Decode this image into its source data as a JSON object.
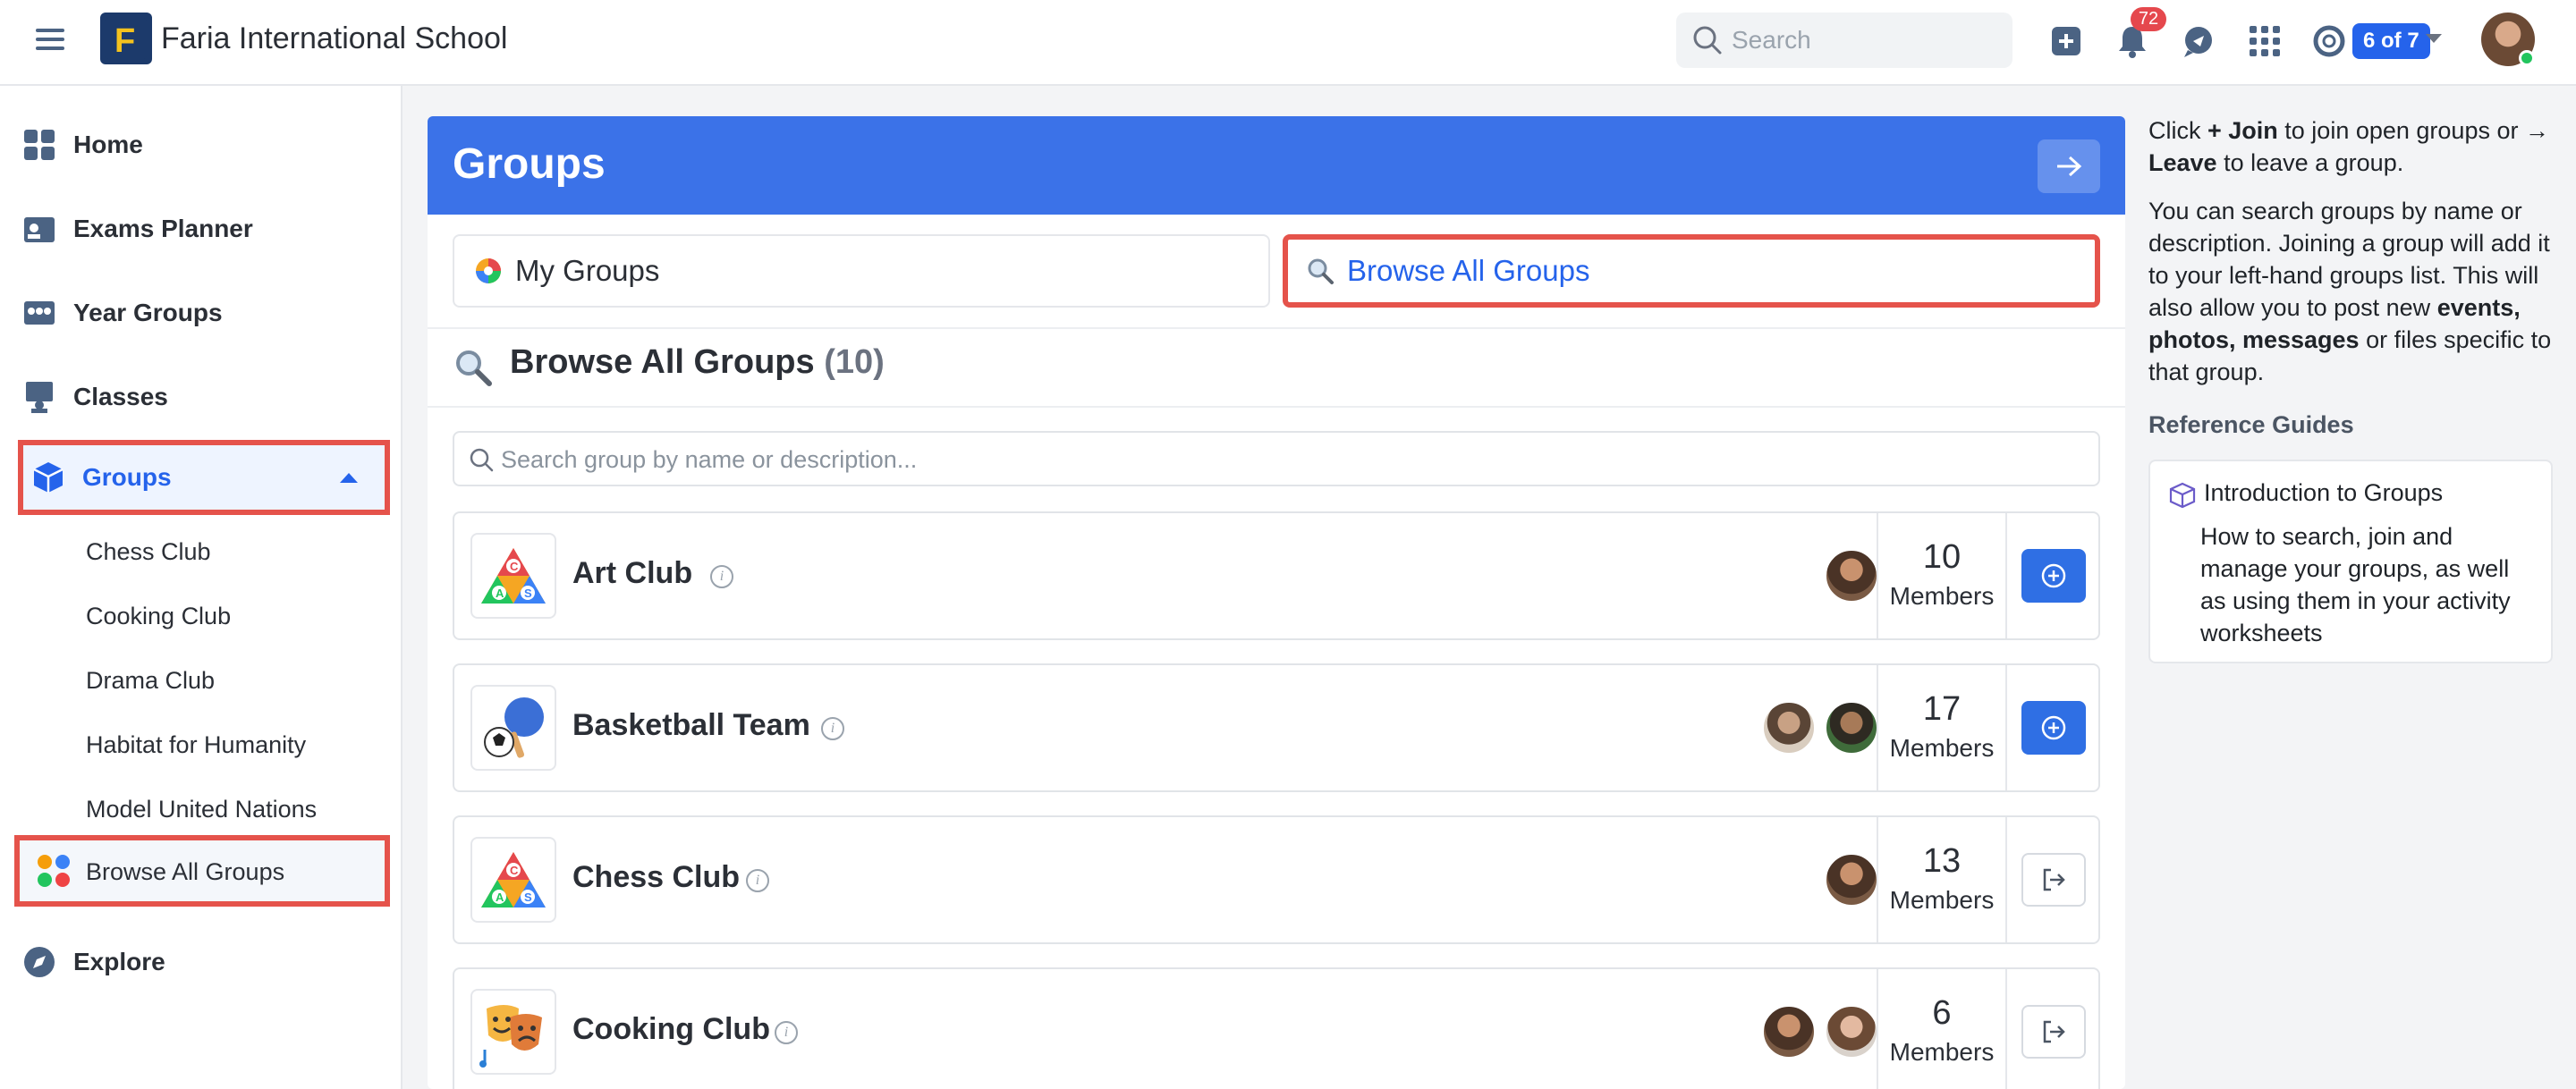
{
  "topbar": {
    "school_name": "Faria International School",
    "logo_letter": "F",
    "search_placeholder": "Search",
    "notification_count": "72",
    "account_pill": "6 of 7"
  },
  "sidebar": {
    "items": [
      {
        "label": "Home",
        "icon": "home-icon"
      },
      {
        "label": "Exams Planner",
        "icon": "exams-planner-icon"
      },
      {
        "label": "Year Groups",
        "icon": "year-groups-icon"
      },
      {
        "label": "Classes",
        "icon": "classes-icon"
      },
      {
        "label": "Groups",
        "icon": "groups-icon"
      },
      {
        "label": "Explore",
        "icon": "compass-icon"
      }
    ],
    "sub_items": [
      {
        "label": "Chess Club"
      },
      {
        "label": "Cooking Club"
      },
      {
        "label": "Drama Club"
      },
      {
        "label": "Habitat for Humanity"
      },
      {
        "label": "Model United Nations"
      },
      {
        "label": "Browse All Groups"
      }
    ]
  },
  "main": {
    "header_title": "Groups",
    "tabs": [
      {
        "label": "My Groups"
      },
      {
        "label": "Browse All Groups"
      }
    ],
    "section_title": "Browse All Groups",
    "section_count": "(10)",
    "search_placeholder": "Search group by name or description...",
    "groups": [
      {
        "name": "Art Club",
        "members": "10",
        "members_label": "Members",
        "action": "join"
      },
      {
        "name": "Basketball Team",
        "members": "17",
        "members_label": "Members",
        "action": "join"
      },
      {
        "name": "Chess Club",
        "members": "13",
        "members_label": "Members",
        "action": "leave"
      },
      {
        "name": "Cooking Club",
        "members": "6",
        "members_label": "Members",
        "action": "leave"
      }
    ]
  },
  "help": {
    "p1_a": "Click ",
    "p1_join": "+ Join",
    "p1_b": " to join open groups or ",
    "p1_leave": "→ Leave",
    "p1_c": " to leave a group.",
    "p2_a": "You can search groups by name or description. Joining a group will add it to your left-hand groups list. This will also allow you to post new ",
    "p2_bold": "events, photos, messages",
    "p2_b": " or files specific to that group.",
    "ref_title": "Reference Guides",
    "ref_card_title": "Introduction to Groups",
    "ref_card_desc": "How to search, join and manage your groups, as well as using them in your activity worksheets"
  },
  "colors": {
    "accent": "#3b72e8",
    "highlight": "#e5534b",
    "link": "#2563eb"
  }
}
